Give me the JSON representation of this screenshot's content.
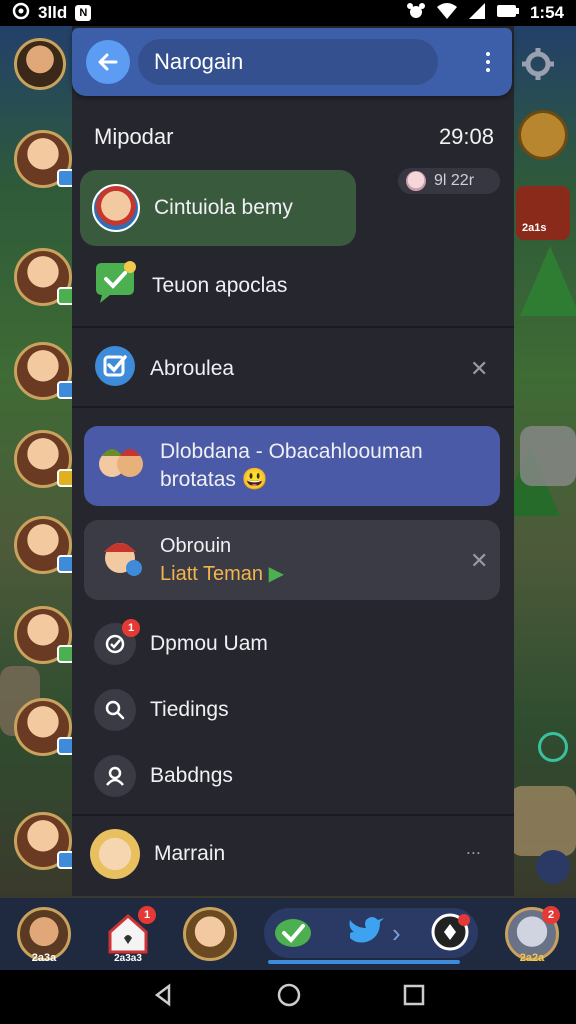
{
  "status_bar": {
    "left_text": "3lld",
    "time": "1:54"
  },
  "header": {
    "title": "Narogain"
  },
  "section": {
    "title": "Mipodar",
    "time": "29:08"
  },
  "timestamp_pill": {
    "text": "9l 22r"
  },
  "items": {
    "chat1": {
      "label": "Cintuiola bemy"
    },
    "chat2": {
      "label": "Teuon apoclas"
    },
    "notice": {
      "label": "Abroulea"
    },
    "highlight": {
      "line1": "Dlobdana - Obacahloouman",
      "line2": "brotatas"
    },
    "invite": {
      "line1": "Obrouin",
      "line2": "Liatt Teman"
    },
    "menu1": {
      "label": "Dpmou Uam",
      "badge": "1"
    },
    "menu2": {
      "label": "Tiedings"
    },
    "menu3": {
      "label": "Babdngs"
    },
    "profile": {
      "label": "Marrain"
    }
  },
  "tabbar": {
    "item1_label": "2a3a",
    "item2_label": "2a3a3",
    "item2_badge": "1",
    "item5_badge": "2",
    "item5_label": "2a2a"
  },
  "right_rail": {
    "label": "2a1s"
  },
  "colors": {
    "header": "#3d5ea8",
    "drawer": "#26272e",
    "accent_green": "#3a5a3e",
    "highlight_blue": "#4a5aa6"
  }
}
